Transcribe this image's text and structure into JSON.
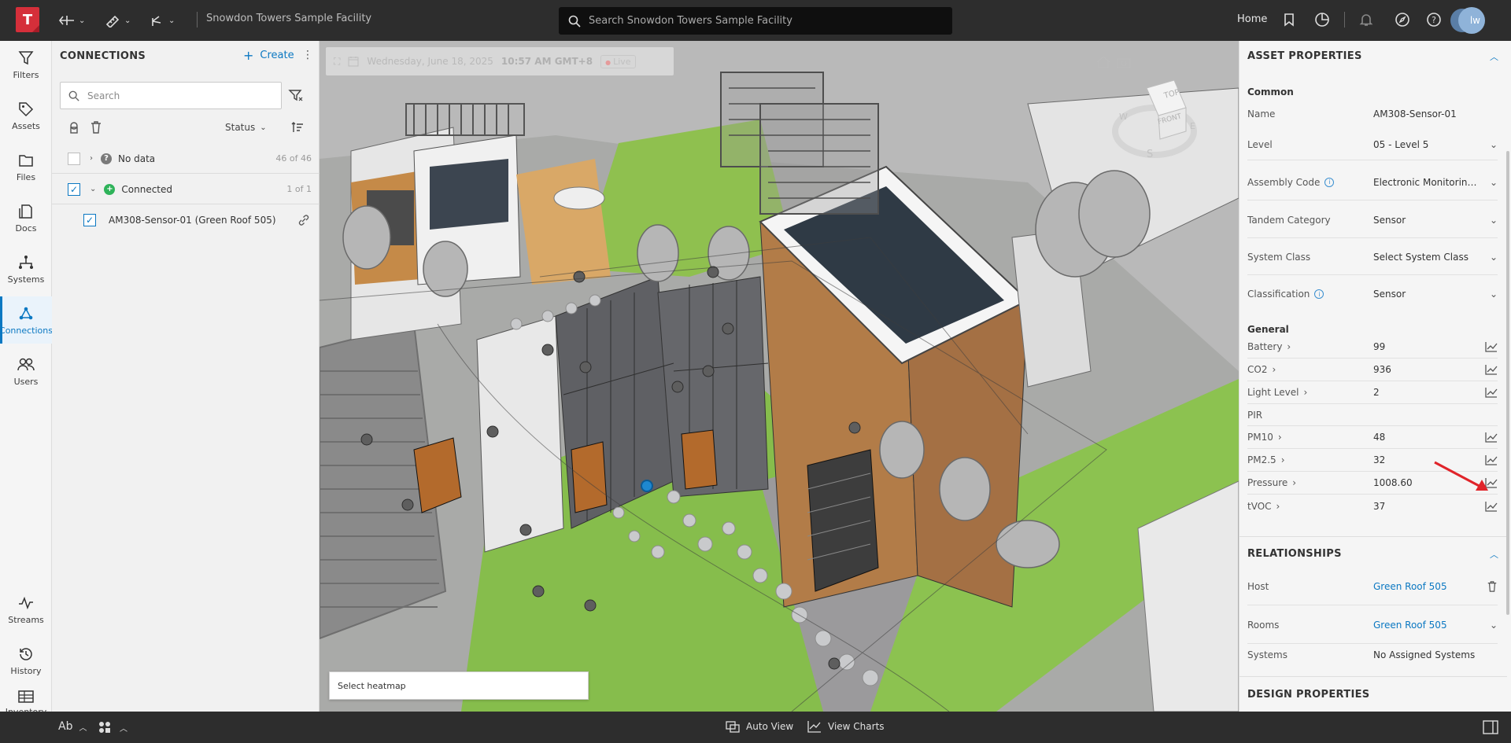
{
  "topbar": {
    "logo_letter": "T",
    "facility_name": "Snowdon Towers Sample Facility",
    "search_placeholder": "Search Snowdon Towers Sample Facility",
    "home_label": "Home",
    "avatar_initials": "lw"
  },
  "rail": {
    "items": [
      {
        "label": "Filters",
        "icon": "funnel-icon"
      },
      {
        "label": "Assets",
        "icon": "tag-icon"
      },
      {
        "label": "Files",
        "icon": "folder-icon"
      },
      {
        "label": "Docs",
        "icon": "documents-icon"
      },
      {
        "label": "Systems",
        "icon": "hierarchy-icon"
      },
      {
        "label": "Connections",
        "icon": "connections-icon",
        "active": true
      },
      {
        "label": "Users",
        "icon": "users-icon"
      },
      {
        "label": "Streams",
        "icon": "pulse-icon"
      },
      {
        "label": "History",
        "icon": "history-icon"
      },
      {
        "label": "Inventory",
        "icon": "table-icon"
      }
    ]
  },
  "connections": {
    "title": "CONNECTIONS",
    "create_label": "Create",
    "search_placeholder": "Search",
    "status_label": "Status",
    "groups": [
      {
        "label": "No data",
        "count": "46 of 46",
        "status_color": "#7a7a7a",
        "status_glyph": "?"
      },
      {
        "label": "Connected",
        "count": "1 of 1",
        "status_color": "#2fb35a",
        "status_glyph": "+"
      }
    ],
    "items": [
      {
        "label": "AM308-Sensor-01 (Green Roof 505)"
      }
    ]
  },
  "viewer": {
    "date": "Wednesday, June 18, 2025",
    "time": "10:57 AM GMT+8",
    "live_label": "Live",
    "heatmap_placeholder": "Select heatmap",
    "viewcube": {
      "top": "TOP",
      "front": "FRONT",
      "w": "W",
      "e": "E",
      "s": "S"
    }
  },
  "asset_properties": {
    "title": "ASSET PROPERTIES",
    "common_label": "Common",
    "common": [
      {
        "key": "Name",
        "value": "AM308-Sensor-01"
      },
      {
        "key": "Level",
        "value": "05 - Level 5"
      },
      {
        "key": "Assembly Code",
        "value": "Electronic Monitoring and Control"
      },
      {
        "key": "Tandem Category",
        "value": "Sensor"
      },
      {
        "key": "System Class",
        "value": "Select System Class"
      },
      {
        "key": "Classification",
        "value": "Sensor"
      }
    ],
    "general_label": "General",
    "general": [
      {
        "key": "Battery",
        "value": "99"
      },
      {
        "key": "CO2",
        "value": "936"
      },
      {
        "key": "Light Level",
        "value": "2"
      },
      {
        "key": "PIR",
        "value": ""
      },
      {
        "key": "PM10",
        "value": "48"
      },
      {
        "key": "PM2.5",
        "value": "32"
      },
      {
        "key": "Pressure",
        "value": "1008.60"
      },
      {
        "key": "tVOC",
        "value": "37"
      }
    ]
  },
  "relationships": {
    "title": "RELATIONSHIPS",
    "host_key": "Host",
    "host_value": "Green Roof 505",
    "rooms_key": "Rooms",
    "rooms_value": "Green Roof 505",
    "systems_key": "Systems",
    "systems_value": "No Assigned Systems"
  },
  "design_properties": {
    "title": "DESIGN PROPERTIES"
  },
  "bottombar": {
    "text_toggle": "Ab",
    "auto_view": "Auto View",
    "view_charts": "View Charts"
  },
  "colors": {
    "accent": "#0b78c2",
    "brand": "#d52f3a",
    "annotation_arrow": "#e0242a"
  }
}
